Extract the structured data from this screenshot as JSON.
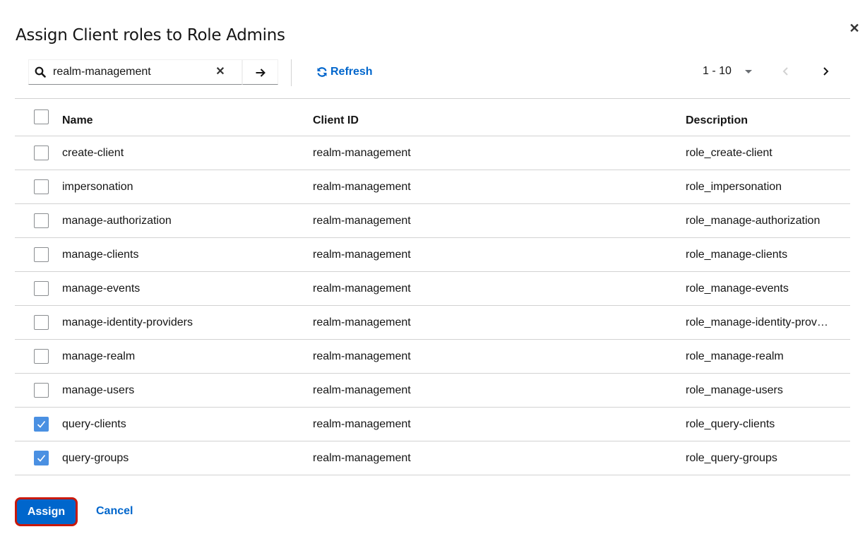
{
  "modal": {
    "title": "Assign Client roles to Role Admins",
    "close_icon": "close-icon"
  },
  "toolbar": {
    "search": {
      "value": "realm-management",
      "icon": "search-icon",
      "clear_icon": "clear-icon"
    },
    "go_icon": "arrow-right-icon",
    "refresh_label": "Refresh",
    "refresh_icon": "sync-icon",
    "pagination": {
      "range": "1 - 10"
    }
  },
  "table": {
    "columns": {
      "name": "Name",
      "client_id": "Client ID",
      "description": "Description"
    },
    "rows": [
      {
        "name": "create-client",
        "client_id": "realm-management",
        "description": "role_create-client",
        "checked": false
      },
      {
        "name": "impersonation",
        "client_id": "realm-management",
        "description": "role_impersonation",
        "checked": false
      },
      {
        "name": "manage-authorization",
        "client_id": "realm-management",
        "description": "role_manage-authorization",
        "checked": false
      },
      {
        "name": "manage-clients",
        "client_id": "realm-management",
        "description": "role_manage-clients",
        "checked": false
      },
      {
        "name": "manage-events",
        "client_id": "realm-management",
        "description": "role_manage-events",
        "checked": false
      },
      {
        "name": "manage-identity-providers",
        "client_id": "realm-management",
        "description": "role_manage-identity-provi…",
        "checked": false
      },
      {
        "name": "manage-realm",
        "client_id": "realm-management",
        "description": "role_manage-realm",
        "checked": false
      },
      {
        "name": "manage-users",
        "client_id": "realm-management",
        "description": "role_manage-users",
        "checked": false
      },
      {
        "name": "query-clients",
        "client_id": "realm-management",
        "description": "role_query-clients",
        "checked": true
      },
      {
        "name": "query-groups",
        "client_id": "realm-management",
        "description": "role_query-groups",
        "checked": true
      }
    ]
  },
  "footer": {
    "assign_label": "Assign",
    "cancel_label": "Cancel"
  },
  "colors": {
    "primary": "#0066cc",
    "focus_ring": "#c9190b",
    "checked_box": "#4a90e2"
  }
}
